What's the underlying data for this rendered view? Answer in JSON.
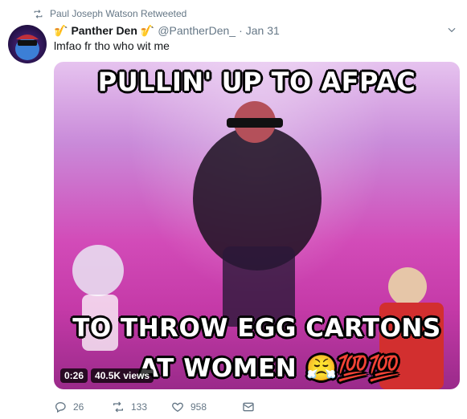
{
  "retweet": {
    "label": "Paul Joseph Watson Retweeted"
  },
  "tweet": {
    "display_name": "Panther Den",
    "name_emoji": "🎷",
    "handle": "@PantherDen_",
    "separator": "·",
    "date": "Jan 31",
    "text": "lmfao fr tho who wit me"
  },
  "media": {
    "caption_top": "PULLIN' UP TO AFPAC",
    "caption_bottom_line1": "TO THROW EGG CARTONS",
    "caption_bottom_line2": "AT WOMEN 😤💯💯",
    "duration": "0:26",
    "views": "40.5K views"
  },
  "actions": {
    "replies": "26",
    "retweets": "133",
    "likes": "958"
  },
  "colors": {
    "muted": "#657786",
    "text": "#14171a",
    "media_pink": "#d24bb8"
  },
  "icons": {
    "retweet_indicator": "retweet-icon",
    "caret": "chevron-down-icon",
    "reply": "reply-icon",
    "retweet": "retweet-icon",
    "like": "heart-icon",
    "message": "envelope-icon"
  }
}
